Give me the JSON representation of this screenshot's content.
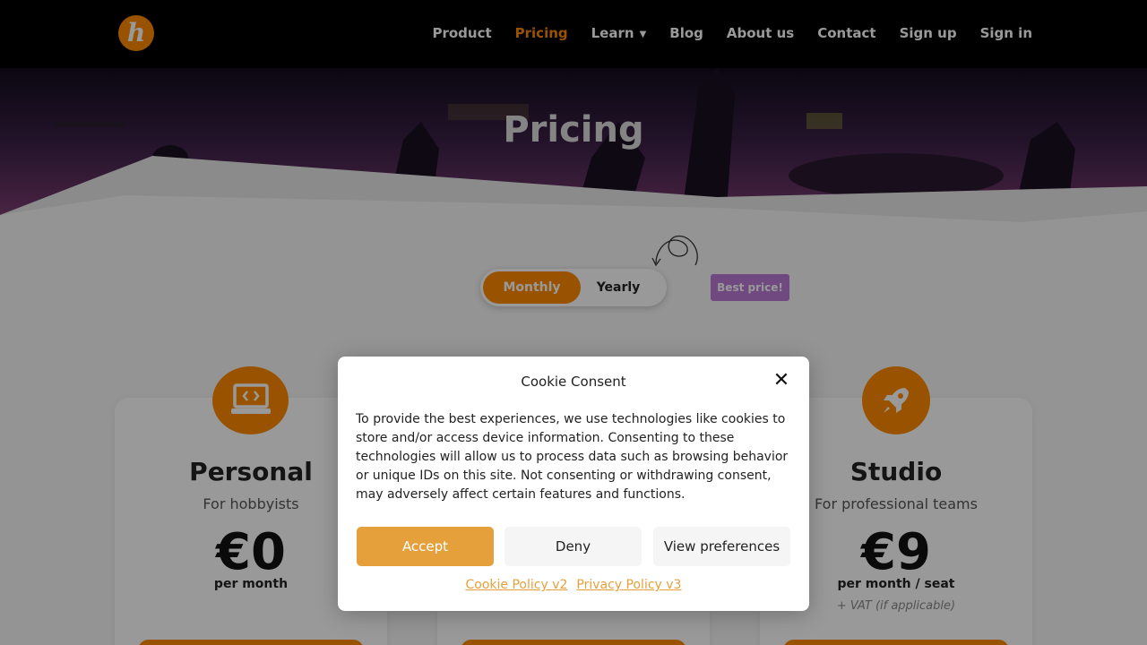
{
  "header": {
    "logo_letter": "h",
    "nav": [
      {
        "label": "Product"
      },
      {
        "label": "Pricing",
        "active": true
      },
      {
        "label": "Learn",
        "has_dropdown": true
      },
      {
        "label": "Blog"
      },
      {
        "label": "About us"
      },
      {
        "label": "Contact"
      },
      {
        "label": "Sign up"
      },
      {
        "label": "Sign in"
      }
    ]
  },
  "hero": {
    "title": "Pricing"
  },
  "billing_toggle": {
    "monthly_label": "Monthly",
    "yearly_label": "Yearly",
    "selected": "Monthly",
    "badge": "Best price!"
  },
  "plans": [
    {
      "icon": "laptop-code-icon",
      "name": "Personal",
      "subtitle": "For hobbyists",
      "price": "€0",
      "period": "per month",
      "vat": ""
    },
    {
      "icon": "",
      "name": "",
      "subtitle": "",
      "price": "",
      "period": "",
      "vat": ""
    },
    {
      "icon": "rocket-icon",
      "name": "Studio",
      "subtitle": "For professional teams",
      "price": "€9",
      "period": "per month / seat",
      "vat": "+ VAT (if applicable)"
    }
  ],
  "cookie_modal": {
    "title": "Cookie Consent",
    "body": "To provide the best experiences, we use technologies like cookies to store and/or access device information. Consenting to these technologies will allow us to process data such as browsing behavior or unique IDs on this site. Not consenting or withdrawing consent, may adversely affect certain features and functions.",
    "accept_label": "Accept",
    "deny_label": "Deny",
    "prefs_label": "View preferences",
    "links": [
      "Cookie Policy v2",
      "Privacy Policy v3"
    ]
  },
  "colors": {
    "accent": "#ff8a00",
    "consent_accent": "#e5a03c",
    "badge": "#b97ad6"
  }
}
